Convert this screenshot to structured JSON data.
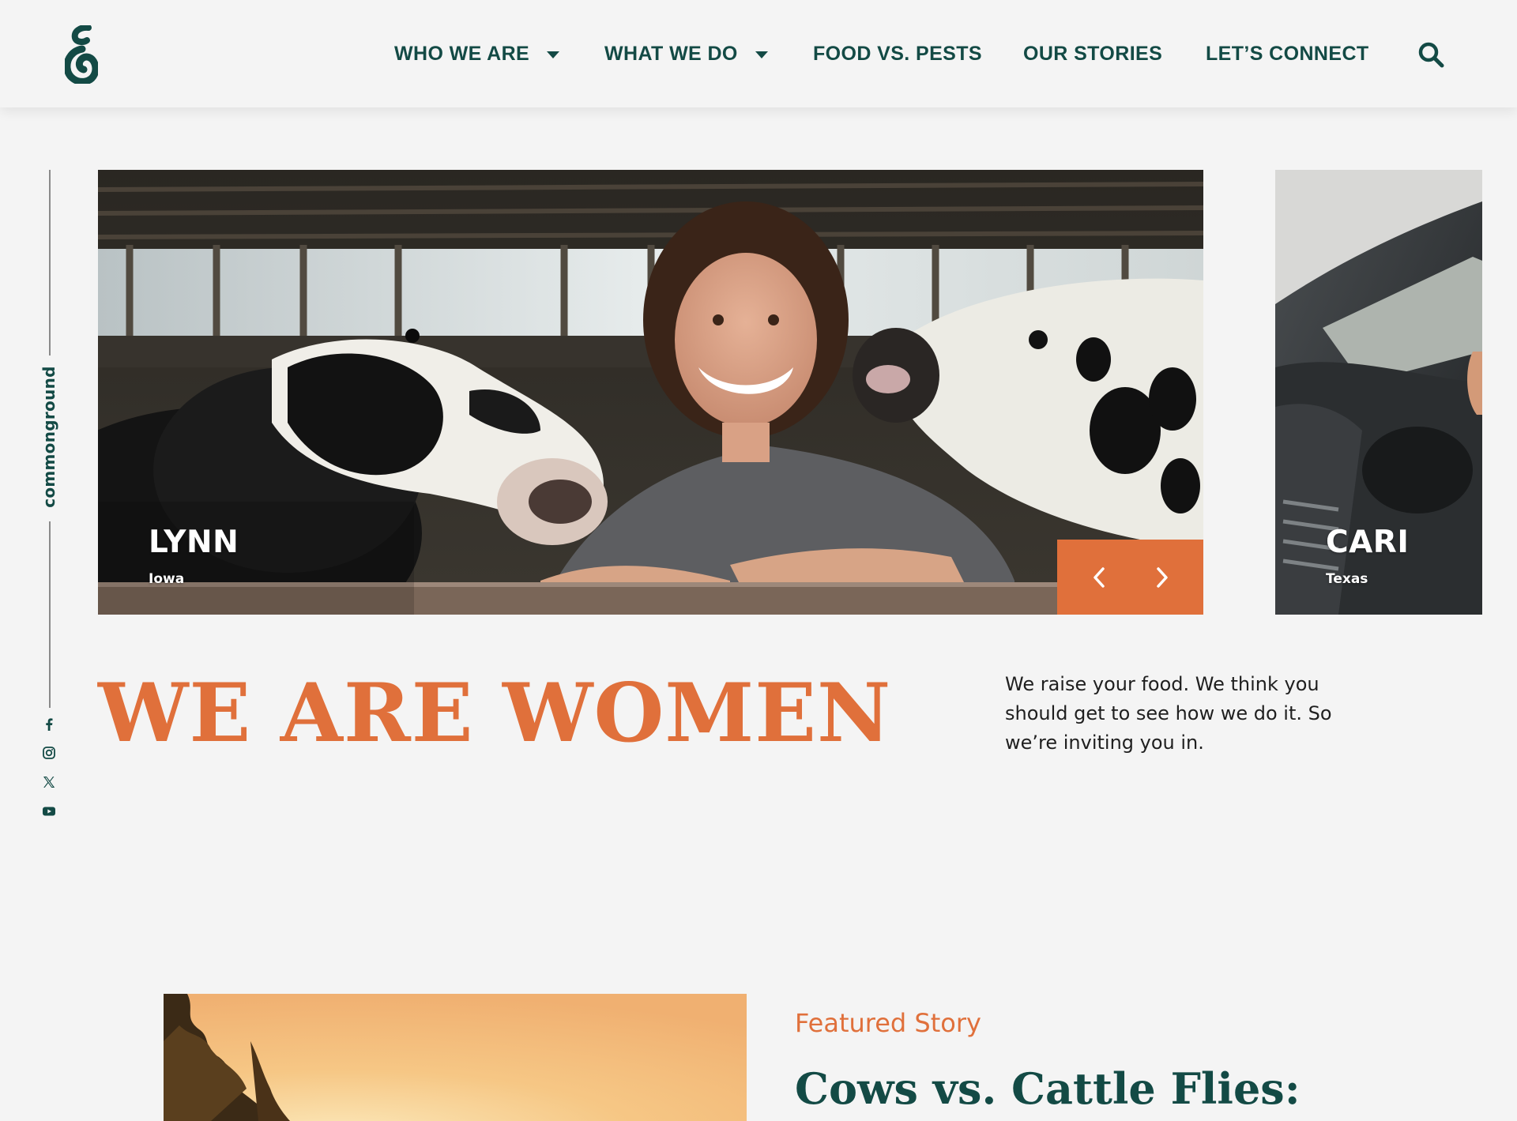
{
  "brand": {
    "name": "commonground",
    "colors": {
      "primary": "#134a45",
      "accent": "#e0703b",
      "background": "#f4f4f4"
    }
  },
  "nav": {
    "items": [
      {
        "label": "WHO WE ARE",
        "has_dropdown": true
      },
      {
        "label": "WHAT WE DO",
        "has_dropdown": true
      },
      {
        "label": "FOOD VS. PESTS",
        "has_dropdown": false
      },
      {
        "label": "OUR STORIES",
        "has_dropdown": false
      },
      {
        "label": "LET’S CONNECT",
        "has_dropdown": false
      }
    ],
    "search_icon": "search-icon"
  },
  "social": [
    "facebook-icon",
    "instagram-icon",
    "x-icon",
    "youtube-icon"
  ],
  "slider": {
    "slides": [
      {
        "name": "LYNN",
        "state": "Iowa"
      },
      {
        "name": "CARI",
        "state": "Texas"
      }
    ],
    "prev_icon": "chevron-left-icon",
    "next_icon": "chevron-right-icon"
  },
  "hero": {
    "title": "WE ARE WOMEN",
    "text": "We raise your food. We think you should get to see how we do it. So we’re inviting you in."
  },
  "featured": {
    "eyebrow": "Featured Story",
    "title": "Cows vs. Cattle Flies:"
  }
}
